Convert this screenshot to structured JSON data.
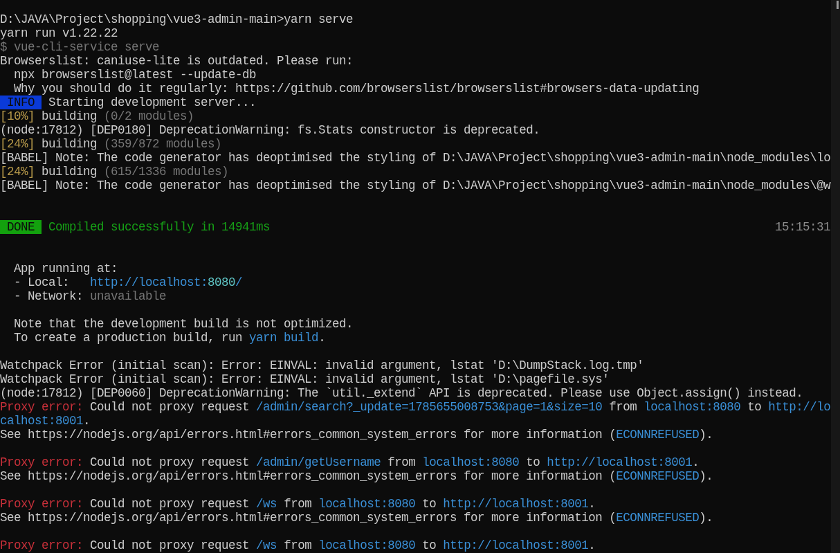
{
  "console": {
    "lines": [
      {
        "kind": "text",
        "segments": [
          {
            "kind": "plain",
            "text": "D:\\JAVA\\Project\\shopping\\vue3-admin-main>yarn serve"
          }
        ]
      },
      {
        "kind": "text",
        "segments": [
          {
            "kind": "plain",
            "text": "yarn run v1.22.22"
          }
        ]
      },
      {
        "kind": "text",
        "segments": [
          {
            "kind": "muted",
            "text": "$ vue-cli-service serve"
          }
        ]
      },
      {
        "kind": "text",
        "segments": [
          {
            "kind": "plain",
            "text": "Browserslist: caniuse-lite is outdated. Please run:"
          }
        ]
      },
      {
        "kind": "text",
        "segments": [
          {
            "kind": "plain",
            "text": "  npx browserslist@latest --update-db"
          }
        ]
      },
      {
        "kind": "text",
        "segments": [
          {
            "kind": "plain",
            "text": "  Why you should do it regularly: https://github.com/browserslist/browserslist#browsers-data-updating"
          }
        ]
      },
      {
        "kind": "text",
        "segments": [
          {
            "kind": "info_badge",
            "text": "INFO"
          },
          {
            "kind": "plain",
            "text": " Starting development server..."
          }
        ]
      },
      {
        "kind": "text",
        "segments": [
          {
            "kind": "progress",
            "text": "[10%]"
          },
          {
            "kind": "plain",
            "text": " building "
          },
          {
            "kind": "muted",
            "text": "(0/2 modules)"
          }
        ]
      },
      {
        "kind": "text",
        "segments": [
          {
            "kind": "plain",
            "text": "(node:17812) [DEP0180] DeprecationWarning: fs.Stats constructor is deprecated."
          }
        ]
      },
      {
        "kind": "text",
        "segments": [
          {
            "kind": "progress",
            "text": "[24%]"
          },
          {
            "kind": "plain",
            "text": " building "
          },
          {
            "kind": "muted",
            "text": "(359/872 modules)"
          }
        ]
      },
      {
        "kind": "text",
        "segments": [
          {
            "kind": "plain",
            "text": "[BABEL] Note: The code generator has deoptimised the styling of D:\\JAVA\\Project\\shopping\\vue3-admin-main\\node_modules\\lo"
          }
        ]
      },
      {
        "kind": "text",
        "segments": [
          {
            "kind": "progress",
            "text": "[24%]"
          },
          {
            "kind": "plain",
            "text": " building "
          },
          {
            "kind": "muted",
            "text": "(615/1336 modules)"
          }
        ]
      },
      {
        "kind": "text",
        "segments": [
          {
            "kind": "plain",
            "text": "[BABEL] Note: The code generator has deoptimised the styling of D:\\JAVA\\Project\\shopping\\vue3-admin-main\\node_modules\\@w"
          }
        ]
      },
      {
        "kind": "blank"
      },
      {
        "kind": "blank"
      },
      {
        "kind": "text",
        "segments": [
          {
            "kind": "done_badge",
            "text": "DONE"
          },
          {
            "kind": "success",
            "text": " Compiled successfully in 14941ms"
          },
          {
            "kind": "time",
            "text": "15:15:31"
          }
        ]
      },
      {
        "kind": "blank"
      },
      {
        "kind": "blank"
      },
      {
        "kind": "text",
        "segments": [
          {
            "kind": "plain",
            "text": "  App running at:"
          }
        ]
      },
      {
        "kind": "text",
        "segments": [
          {
            "kind": "plain",
            "text": "  - Local:   "
          },
          {
            "kind": "accent",
            "text": "http://localhost:"
          },
          {
            "kind": "accent_bright",
            "text": "8080"
          },
          {
            "kind": "accent",
            "text": "/"
          }
        ]
      },
      {
        "kind": "text",
        "segments": [
          {
            "kind": "plain",
            "text": "  - Network: "
          },
          {
            "kind": "muted",
            "text": "unavailable"
          }
        ]
      },
      {
        "kind": "blank"
      },
      {
        "kind": "text",
        "segments": [
          {
            "kind": "plain",
            "text": "  Note that the development build is not optimized."
          }
        ]
      },
      {
        "kind": "text",
        "segments": [
          {
            "kind": "plain",
            "text": "  To create a production build, run "
          },
          {
            "kind": "accent",
            "text": "yarn build"
          },
          {
            "kind": "plain",
            "text": "."
          }
        ]
      },
      {
        "kind": "blank"
      },
      {
        "kind": "text",
        "segments": [
          {
            "kind": "plain",
            "text": "Watchpack Error (initial scan): Error: EINVAL: invalid argument, lstat 'D:\\DumpStack.log.tmp'"
          }
        ]
      },
      {
        "kind": "text",
        "segments": [
          {
            "kind": "plain",
            "text": "Watchpack Error (initial scan): Error: EINVAL: invalid argument, lstat 'D:\\pagefile.sys'"
          }
        ]
      },
      {
        "kind": "text",
        "segments": [
          {
            "kind": "plain",
            "text": "(node:17812) [DEP0060] DeprecationWarning: The `util._extend` API is deprecated. Please use Object.assign() instead."
          }
        ]
      },
      {
        "kind": "text",
        "segments": [
          {
            "kind": "error",
            "text": "Proxy error:"
          },
          {
            "kind": "plain",
            "text": " Could not proxy request "
          },
          {
            "kind": "accent",
            "text": "/admin/search?_update=1785655008753&page=1&size=10"
          },
          {
            "kind": "plain",
            "text": " from "
          },
          {
            "kind": "accent",
            "text": "localhost:8080"
          },
          {
            "kind": "plain",
            "text": " to "
          },
          {
            "kind": "accent",
            "text": "http://lo"
          }
        ]
      },
      {
        "kind": "text",
        "segments": [
          {
            "kind": "accent",
            "text": "calhost:8001"
          },
          {
            "kind": "plain",
            "text": "."
          }
        ]
      },
      {
        "kind": "text",
        "segments": [
          {
            "kind": "plain",
            "text": "See https://nodejs.org/api/errors.html#errors_common_system_errors for more information ("
          },
          {
            "kind": "accent",
            "text": "ECONNREFUSED"
          },
          {
            "kind": "plain",
            "text": ")."
          }
        ]
      },
      {
        "kind": "blank"
      },
      {
        "kind": "text",
        "segments": [
          {
            "kind": "error",
            "text": "Proxy error:"
          },
          {
            "kind": "plain",
            "text": " Could not proxy request "
          },
          {
            "kind": "accent",
            "text": "/admin/getUsername"
          },
          {
            "kind": "plain",
            "text": " from "
          },
          {
            "kind": "accent",
            "text": "localhost:8080"
          },
          {
            "kind": "plain",
            "text": " to "
          },
          {
            "kind": "accent",
            "text": "http://localhost:8001"
          },
          {
            "kind": "plain",
            "text": "."
          }
        ]
      },
      {
        "kind": "text",
        "segments": [
          {
            "kind": "plain",
            "text": "See https://nodejs.org/api/errors.html#errors_common_system_errors for more information ("
          },
          {
            "kind": "accent",
            "text": "ECONNREFUSED"
          },
          {
            "kind": "plain",
            "text": ")."
          }
        ]
      },
      {
        "kind": "blank"
      },
      {
        "kind": "text",
        "segments": [
          {
            "kind": "error",
            "text": "Proxy error:"
          },
          {
            "kind": "plain",
            "text": " Could not proxy request "
          },
          {
            "kind": "accent",
            "text": "/ws"
          },
          {
            "kind": "plain",
            "text": " from "
          },
          {
            "kind": "accent",
            "text": "localhost:8080"
          },
          {
            "kind": "plain",
            "text": " to "
          },
          {
            "kind": "accent",
            "text": "http://localhost:8001"
          },
          {
            "kind": "plain",
            "text": "."
          }
        ]
      },
      {
        "kind": "text",
        "segments": [
          {
            "kind": "plain",
            "text": "See https://nodejs.org/api/errors.html#errors_common_system_errors for more information ("
          },
          {
            "kind": "accent",
            "text": "ECONNREFUSED"
          },
          {
            "kind": "plain",
            "text": ")."
          }
        ]
      },
      {
        "kind": "blank"
      },
      {
        "kind": "text",
        "segments": [
          {
            "kind": "error",
            "text": "Proxy error:"
          },
          {
            "kind": "plain",
            "text": " Could not proxy request "
          },
          {
            "kind": "accent",
            "text": "/ws"
          },
          {
            "kind": "plain",
            "text": " from "
          },
          {
            "kind": "accent",
            "text": "localhost:8080"
          },
          {
            "kind": "plain",
            "text": " to "
          },
          {
            "kind": "accent",
            "text": "http://localhost:8001"
          },
          {
            "kind": "plain",
            "text": "."
          }
        ]
      }
    ]
  }
}
